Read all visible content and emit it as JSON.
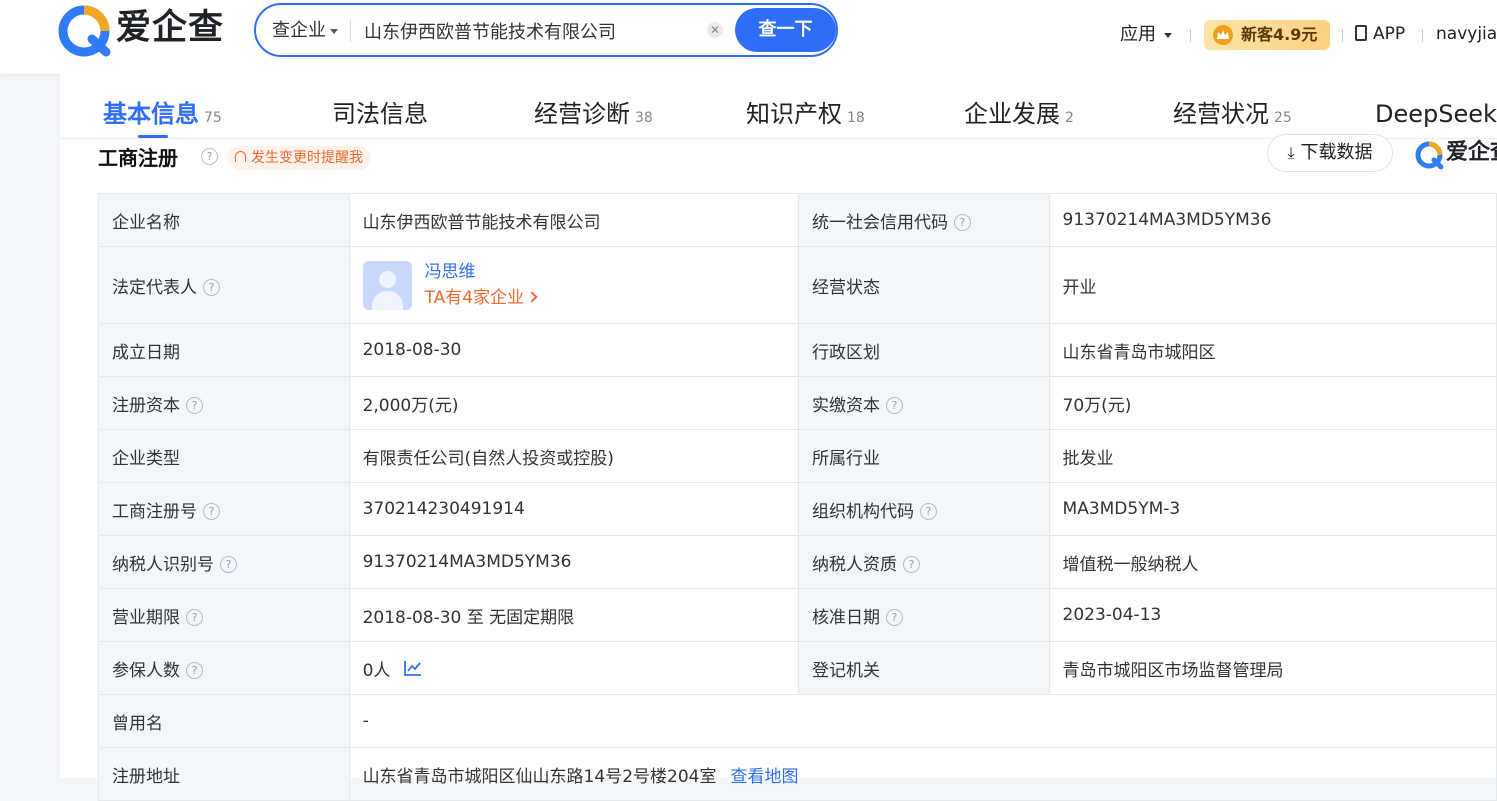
{
  "header": {
    "logo_text": "爱企查",
    "search": {
      "type_label": "查企业",
      "query": "山东伊西欧普节能技术有限公司",
      "button_label": "查一下"
    },
    "apps_label": "应用",
    "vip_label": "新客4.9元",
    "app_label": "APP",
    "user_name": "navyjian"
  },
  "tabs": [
    {
      "label": "基本信息",
      "count": "75"
    },
    {
      "label": "司法信息",
      "count": ""
    },
    {
      "label": "经营诊断",
      "count": "38"
    },
    {
      "label": "知识产权",
      "count": "18"
    },
    {
      "label": "企业发展",
      "count": "2"
    },
    {
      "label": "经营状况",
      "count": "25"
    },
    {
      "label": "DeepSeek",
      "count": ""
    }
  ],
  "section": {
    "title": "工商注册",
    "remind_label": "发生变更时提醒我",
    "download_label": "下载数据",
    "brand_text": "爱企查"
  },
  "table": {
    "company_name_label": "企业名称",
    "company_name": "山东伊西欧普节能技术有限公司",
    "credit_code_label": "统一社会信用代码",
    "credit_code": "91370214MA3MD5YM36",
    "legal_rep_label": "法定代表人",
    "legal_rep_name": "冯思维",
    "legal_rep_link": "TA有4家企业",
    "status_label": "经营状态",
    "status": "开业",
    "founded_label": "成立日期",
    "founded": "2018-08-30",
    "region_label": "行政区划",
    "region": "山东省青岛市城阳区",
    "reg_capital_label": "注册资本",
    "reg_capital": "2,000万(元)",
    "paid_capital_label": "实缴资本",
    "paid_capital": "70万(元)",
    "type_label": "企业类型",
    "type": "有限责任公司(自然人投资或控股)",
    "industry_label": "所属行业",
    "industry": "批发业",
    "reg_no_label": "工商注册号",
    "reg_no": "370214230491914",
    "org_code_label": "组织机构代码",
    "org_code": "MA3MD5YM-3",
    "tax_id_label": "纳税人识别号",
    "tax_id": "91370214MA3MD5YM36",
    "tax_qual_label": "纳税人资质",
    "tax_qual": "增值税一般纳税人",
    "term_label": "营业期限",
    "term": "2018-08-30 至 无固定期限",
    "approval_label": "核准日期",
    "approval": "2023-04-13",
    "insured_label": "参保人数",
    "insured": "0人",
    "authority_label": "登记机关",
    "authority": "青岛市城阳区市场监督管理局",
    "former_name_label": "曾用名",
    "former_name": "-",
    "address_label": "注册地址",
    "address": "山东省青岛市城阳区仙山东路14号2号楼204室",
    "map_link": "查看地图"
  },
  "colors": {
    "accent": "#2f6ff7",
    "orange": "#ef6a2f",
    "label_bg": "#f3f6fb"
  }
}
